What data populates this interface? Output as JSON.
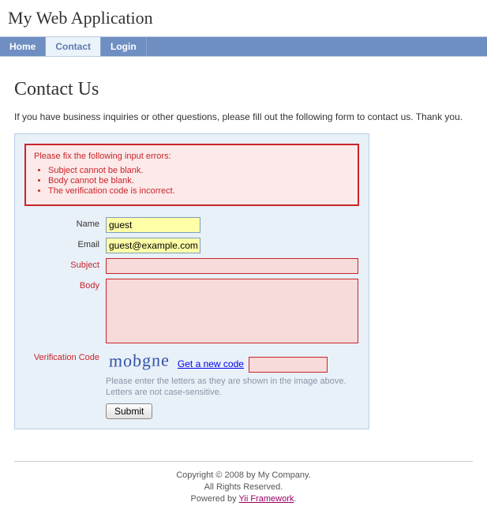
{
  "header": {
    "app_title": "My Web Application"
  },
  "nav": {
    "items": [
      "Home",
      "Contact",
      "Login"
    ],
    "active_index": 1
  },
  "page": {
    "title": "Contact Us",
    "intro": "If you have business inquiries or other questions, please fill out the following form to contact us. Thank you."
  },
  "errors": {
    "heading": "Please fix the following input errors:",
    "items": [
      "Subject cannot be blank.",
      "Body cannot be blank.",
      "The verification code is incorrect."
    ]
  },
  "form": {
    "name": {
      "label": "Name",
      "value": "guest",
      "error": false
    },
    "email": {
      "label": "Email",
      "value": "guest@example.com",
      "error": false
    },
    "subject": {
      "label": "Subject",
      "value": "",
      "error": true
    },
    "body": {
      "label": "Body",
      "value": "",
      "error": true
    },
    "captcha": {
      "label": "Verification Code",
      "image_text": "mobgne",
      "new_code_link": "Get a new code",
      "value": "",
      "error": true,
      "hint": "Please enter the letters as they are shown in the image above. Letters are not case-sensitive."
    },
    "submit_label": "Submit"
  },
  "footer": {
    "line1": "Copyright © 2008 by My Company.",
    "line2": "All Rights Reserved.",
    "powered_prefix": "Powered by ",
    "powered_link": "Yii Framework",
    "powered_suffix": "."
  }
}
